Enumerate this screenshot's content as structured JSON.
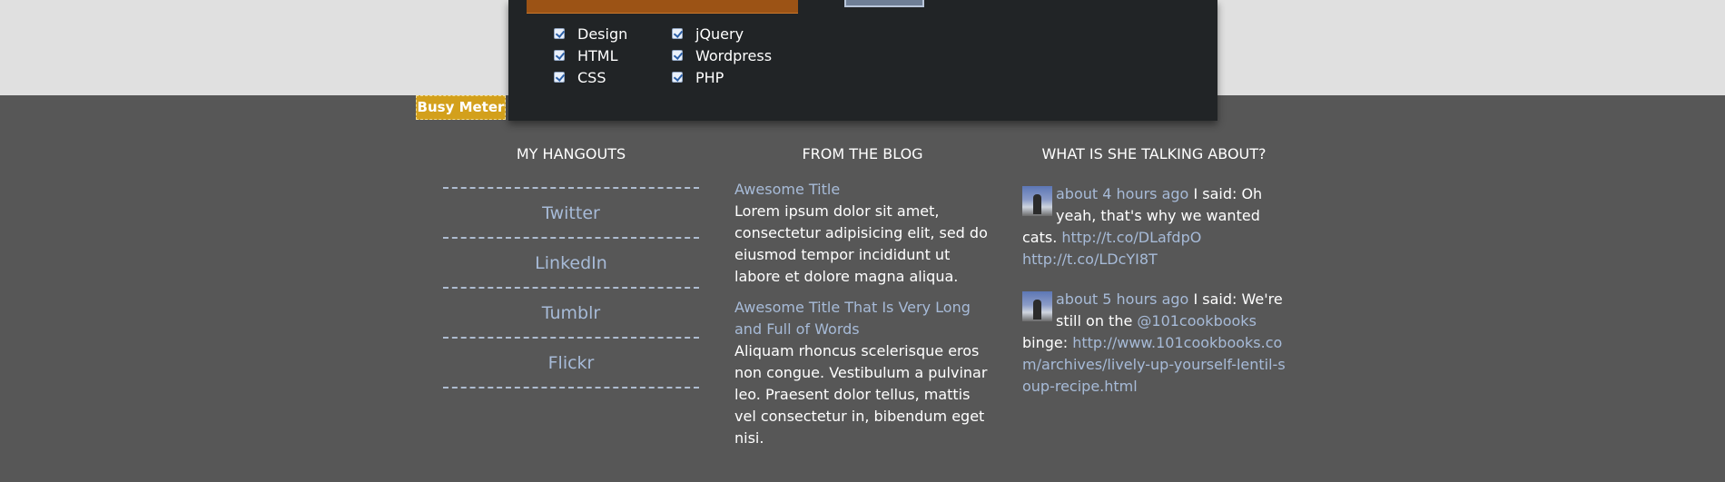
{
  "skills": {
    "left": [
      "Design",
      "HTML",
      "CSS"
    ],
    "right": [
      "jQuery",
      "Wordpress",
      "PHP"
    ]
  },
  "busy_meter": {
    "label": "Busy Meter"
  },
  "hangouts": {
    "title": "MY HANGOUTS",
    "links": [
      "Twitter",
      "LinkedIn",
      "Tumblr",
      "Flickr"
    ]
  },
  "blog": {
    "title": "FROM THE BLOG",
    "posts": [
      {
        "title": "Awesome Title",
        "excerpt": "Lorem ipsum dolor sit amet, consectetur adipisicing elit, sed do eiusmod tempor incididunt ut labore et dolore magna aliqua."
      },
      {
        "title": "Awesome Title That Is Very Long and Full of Words",
        "excerpt": "Aliquam rhoncus scelerisque eros non congue. Vestibulum a pulvinar leo. Praesent dolor tellus, mattis vel consectetur in, bibendum eget nisi."
      }
    ]
  },
  "tweets": {
    "title": "WHAT IS SHE TALKING ABOUT?",
    "items": [
      {
        "time": "about 4 hours ago",
        "text": "I said: Oh yeah, that's why we wanted cats. ",
        "link1": "http://t.co/DLafdpO",
        "link2": "http://t.co/LDcYI8T"
      },
      {
        "time": "about 5 hours ago",
        "text1": "I said: We're still on the ",
        "mention": "@101cookbooks",
        "text2": " binge: ",
        "link": "http://www.101cookbooks.com/archives/lively-up-yourself-lentil-soup-recipe.html"
      }
    ]
  }
}
